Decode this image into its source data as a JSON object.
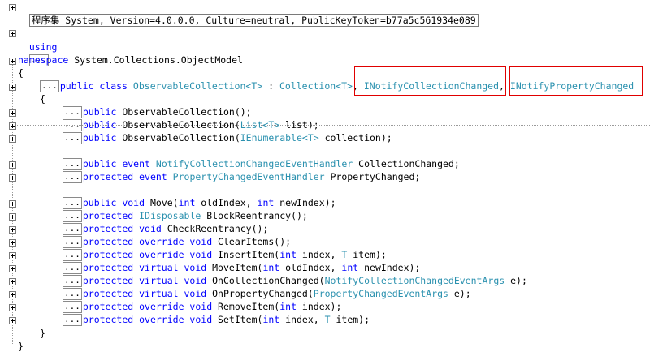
{
  "header": {
    "assembly_text": "程序集 System, Version=4.0.0.0, Culture=neutral, PublicKeyToken=b77a5c561934e089"
  },
  "usings": {
    "keyword": "using",
    "collapsed": "..."
  },
  "namespace": {
    "keyword": "namespace",
    "name": "System.Collections.ObjectModel",
    "open_brace": "{",
    "close_brace": "}"
  },
  "class_decl": {
    "collapsed": "...",
    "kw1": "public",
    "kw2": "class",
    "name": "ObservableCollection<T>",
    "colon": " : ",
    "base": "Collection<T>",
    "comma": ",",
    "iface1": "INotifyCollectionChanged",
    "comma2": ",",
    "iface2": "INotifyPropertyChanged",
    "open_brace": "{",
    "close_brace": "}"
  },
  "members": [
    {
      "parts": [
        [
          "kw",
          "public"
        ],
        [
          "txt",
          " ObservableCollection();"
        ]
      ]
    },
    {
      "parts": [
        [
          "kw",
          "public"
        ],
        [
          "txt",
          " ObservableCollection("
        ],
        [
          "ty",
          "List<T>"
        ],
        [
          "txt",
          " list);"
        ]
      ]
    },
    {
      "parts": [
        [
          "kw",
          "public"
        ],
        [
          "txt",
          " ObservableCollection("
        ],
        [
          "ty",
          "IEnumerable<T>"
        ],
        [
          "txt",
          " collection);"
        ]
      ]
    },
    {
      "gap": true
    },
    {
      "parts": [
        [
          "kw",
          "public event"
        ],
        [
          "txt",
          " "
        ],
        [
          "ty",
          "NotifyCollectionChangedEventHandler"
        ],
        [
          "txt",
          " CollectionChanged;"
        ]
      ]
    },
    {
      "parts": [
        [
          "kw",
          "protected event"
        ],
        [
          "txt",
          " "
        ],
        [
          "ty",
          "PropertyChangedEventHandler"
        ],
        [
          "txt",
          " PropertyChanged;"
        ]
      ]
    },
    {
      "gap": true
    },
    {
      "parts": [
        [
          "kw",
          "public void"
        ],
        [
          "txt",
          " Move("
        ],
        [
          "kw",
          "int"
        ],
        [
          "txt",
          " oldIndex, "
        ],
        [
          "kw",
          "int"
        ],
        [
          "txt",
          " newIndex);"
        ]
      ]
    },
    {
      "parts": [
        [
          "kw",
          "protected"
        ],
        [
          "txt",
          " "
        ],
        [
          "ty",
          "IDisposable"
        ],
        [
          "txt",
          " BlockReentrancy();"
        ]
      ]
    },
    {
      "parts": [
        [
          "kw",
          "protected void"
        ],
        [
          "txt",
          " CheckReentrancy();"
        ]
      ]
    },
    {
      "parts": [
        [
          "kw",
          "protected override void"
        ],
        [
          "txt",
          " ClearItems();"
        ]
      ]
    },
    {
      "parts": [
        [
          "kw",
          "protected override void"
        ],
        [
          "txt",
          " InsertItem("
        ],
        [
          "kw",
          "int"
        ],
        [
          "txt",
          " index, "
        ],
        [
          "ty",
          "T"
        ],
        [
          "txt",
          " item);"
        ]
      ]
    },
    {
      "parts": [
        [
          "kw",
          "protected virtual void"
        ],
        [
          "txt",
          " MoveItem("
        ],
        [
          "kw",
          "int"
        ],
        [
          "txt",
          " oldIndex, "
        ],
        [
          "kw",
          "int"
        ],
        [
          "txt",
          " newIndex);"
        ]
      ]
    },
    {
      "parts": [
        [
          "kw",
          "protected virtual void"
        ],
        [
          "txt",
          " OnCollectionChanged("
        ],
        [
          "ty",
          "NotifyCollectionChangedEventArgs"
        ],
        [
          "txt",
          " e);"
        ]
      ]
    },
    {
      "parts": [
        [
          "kw",
          "protected virtual void"
        ],
        [
          "txt",
          " OnPropertyChanged("
        ],
        [
          "ty",
          "PropertyChangedEventArgs"
        ],
        [
          "txt",
          " e);"
        ]
      ]
    },
    {
      "parts": [
        [
          "kw",
          "protected override void"
        ],
        [
          "txt",
          " RemoveItem("
        ],
        [
          "kw",
          "int"
        ],
        [
          "txt",
          " index);"
        ]
      ]
    },
    {
      "parts": [
        [
          "kw",
          "protected override void"
        ],
        [
          "txt",
          " SetItem("
        ],
        [
          "kw",
          "int"
        ],
        [
          "txt",
          " index, "
        ],
        [
          "ty",
          "T"
        ],
        [
          "txt",
          " item);"
        ]
      ]
    }
  ],
  "collapsed_marker": "..."
}
